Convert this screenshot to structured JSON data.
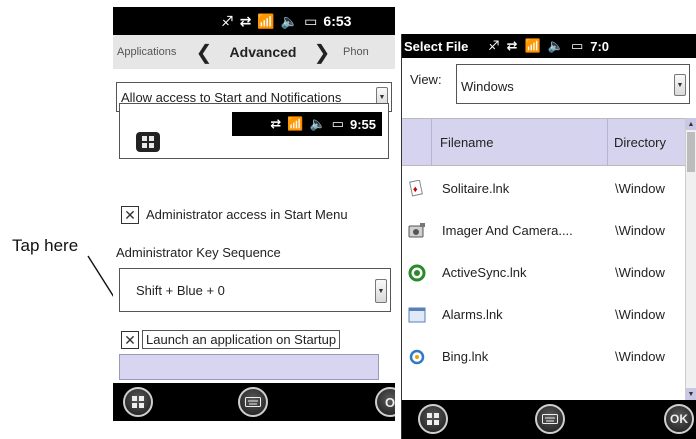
{
  "callout": {
    "text": "Tap here"
  },
  "left": {
    "status": {
      "time": "6:53"
    },
    "tabs": {
      "prev": "Applications",
      "current": "Advanced",
      "next": "Phon"
    },
    "access_select": {
      "value": "Allow access to Start and Notifications"
    },
    "preview": {
      "time": "9:55"
    },
    "admin_access": {
      "label": "Administrator access in Start Menu",
      "checked": "✕"
    },
    "key_sequence": {
      "label": "Administrator Key Sequence",
      "value": "Shift + Blue + 0"
    },
    "launch_startup": {
      "label": "Launch an application on Startup",
      "checked": "✕"
    },
    "softkey_right": "O"
  },
  "right": {
    "status": {
      "title": "Select File",
      "time": "7:0"
    },
    "view": {
      "label": "View:",
      "value": "Windows"
    },
    "columns": {
      "filename": "Filename",
      "directory": "Directory"
    },
    "files": [
      {
        "name": "Solitaire.lnk",
        "dir": "\\Window",
        "icon": "cards-icon"
      },
      {
        "name": "Imager And Camera....",
        "dir": "\\Window",
        "icon": "camera-icon"
      },
      {
        "name": "ActiveSync.lnk",
        "dir": "\\Window",
        "icon": "sync-icon"
      },
      {
        "name": "Alarms.lnk",
        "dir": "\\Window",
        "icon": "clock-icon"
      },
      {
        "name": "Bing.lnk",
        "dir": "\\Window",
        "icon": "bing-icon"
      }
    ],
    "ok_label": "OK"
  }
}
